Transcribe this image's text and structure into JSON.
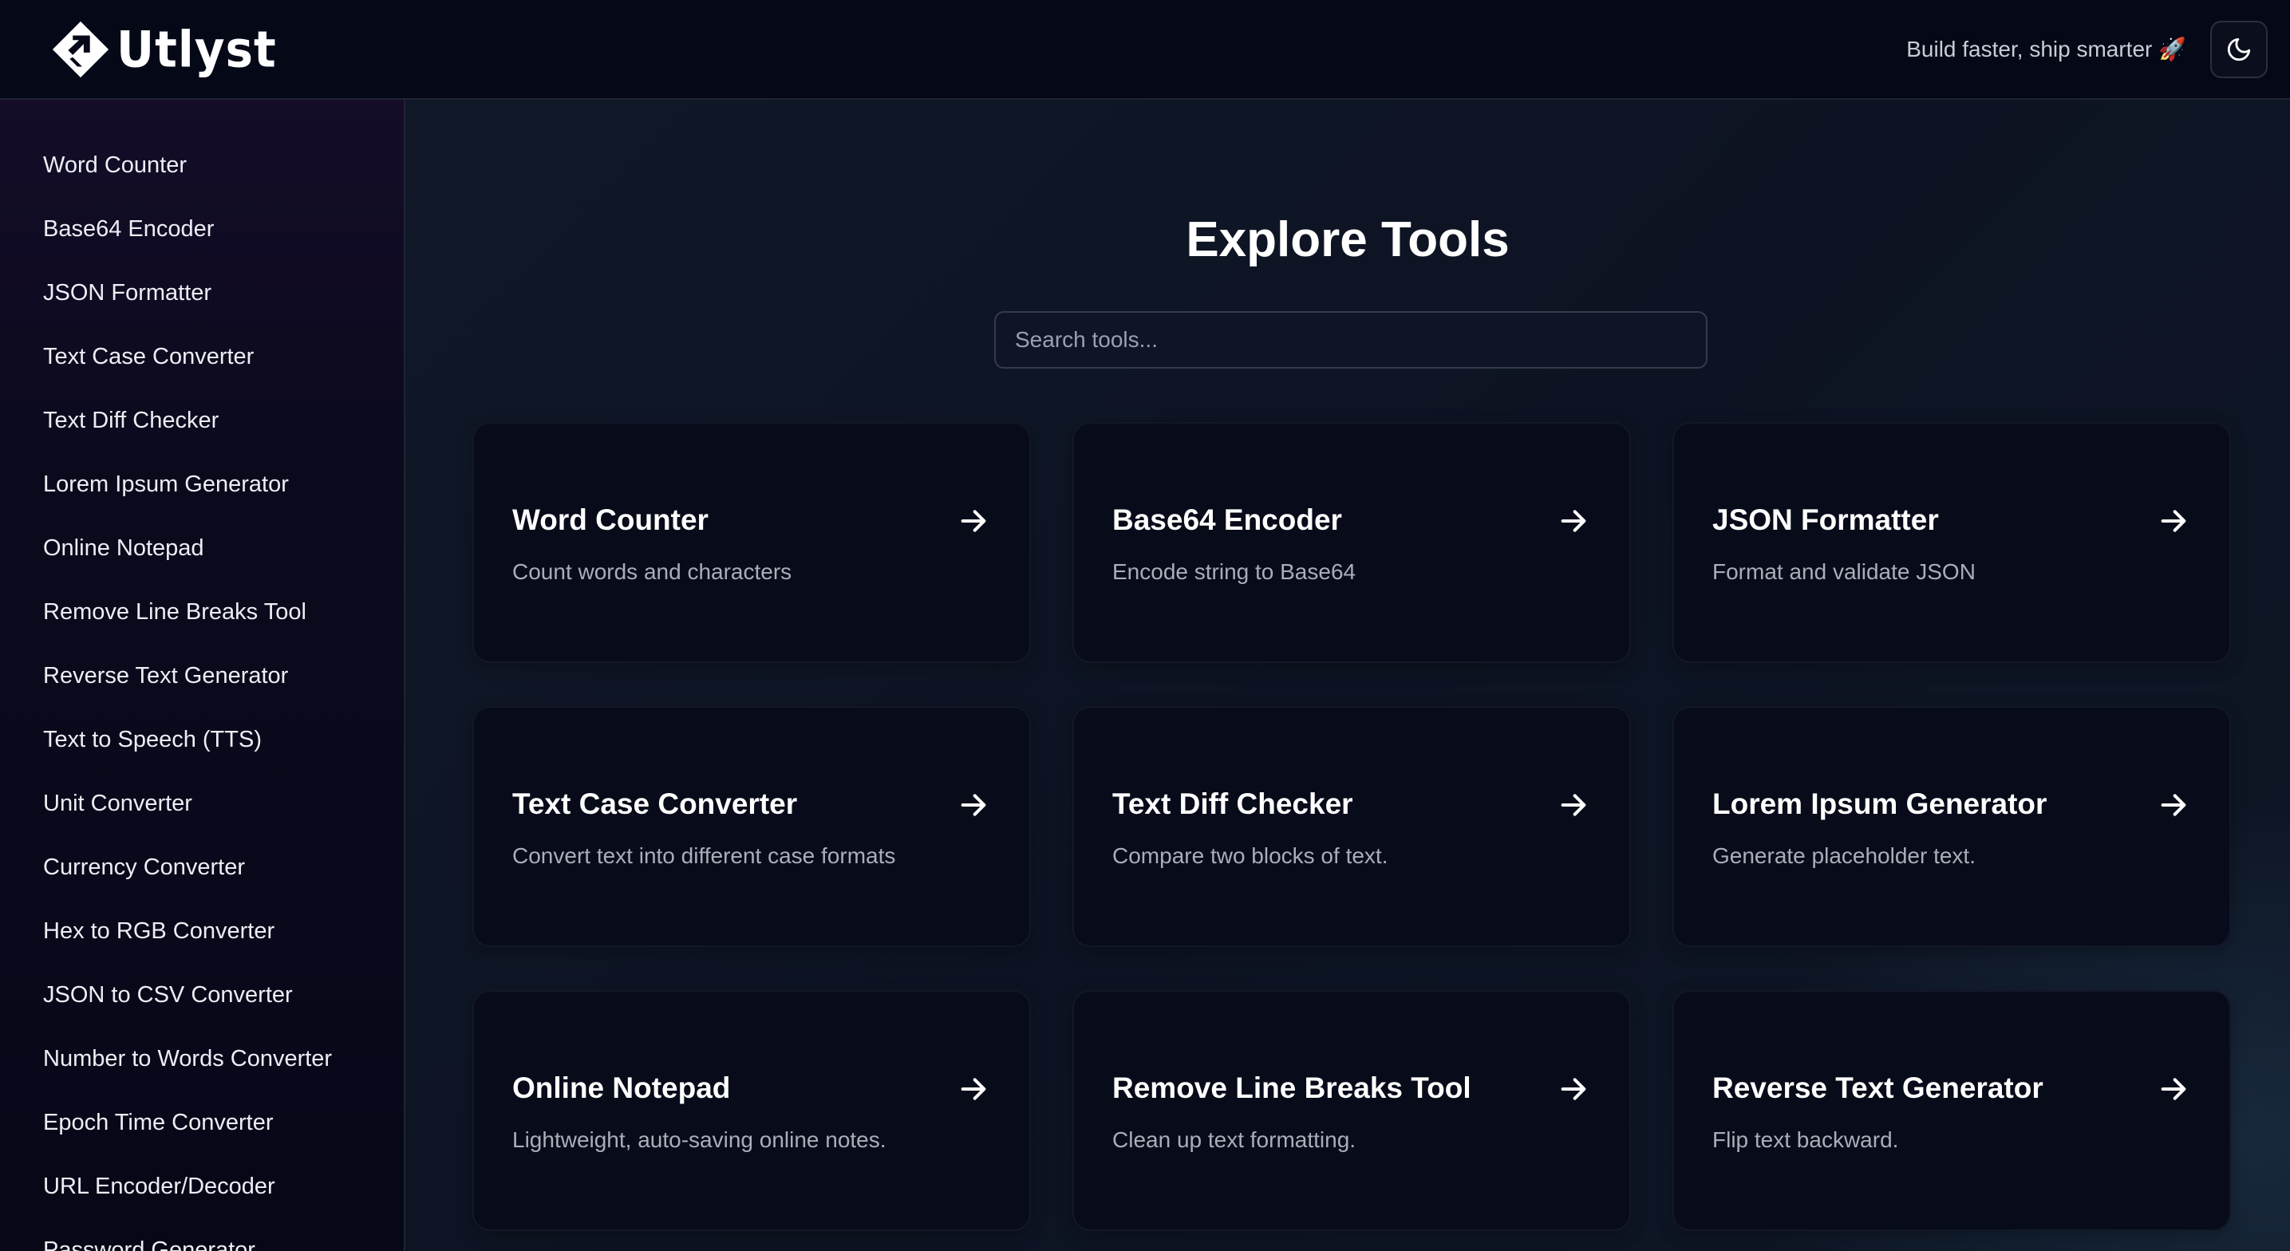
{
  "header": {
    "brand": "Utlyst",
    "tagline": "Build faster, ship smarter 🚀",
    "theme_toggle_icon": "moon-icon"
  },
  "sidebar": {
    "items": [
      {
        "label": "Word Counter"
      },
      {
        "label": "Base64 Encoder"
      },
      {
        "label": "JSON Formatter"
      },
      {
        "label": "Text Case Converter"
      },
      {
        "label": "Text Diff Checker"
      },
      {
        "label": "Lorem Ipsum Generator"
      },
      {
        "label": "Online Notepad"
      },
      {
        "label": "Remove Line Breaks Tool"
      },
      {
        "label": "Reverse Text Generator"
      },
      {
        "label": "Text to Speech (TTS)"
      },
      {
        "label": "Unit Converter"
      },
      {
        "label": "Currency Converter"
      },
      {
        "label": "Hex to RGB Converter"
      },
      {
        "label": "JSON to CSV Converter"
      },
      {
        "label": "Number to Words Converter"
      },
      {
        "label": "Epoch Time Converter"
      },
      {
        "label": "URL Encoder/Decoder"
      },
      {
        "label": "Password Generator"
      }
    ]
  },
  "main": {
    "title": "Explore Tools",
    "search": {
      "placeholder": "Search tools...",
      "value": ""
    },
    "cards": [
      {
        "title": "Word Counter",
        "desc": "Count words and characters"
      },
      {
        "title": "Base64 Encoder",
        "desc": "Encode string to Base64"
      },
      {
        "title": "JSON Formatter",
        "desc": "Format and validate JSON"
      },
      {
        "title": "Text Case Converter",
        "desc": "Convert text into different case formats"
      },
      {
        "title": "Text Diff Checker",
        "desc": "Compare two blocks of text."
      },
      {
        "title": "Lorem Ipsum Generator",
        "desc": "Generate placeholder text."
      },
      {
        "title": "Online Notepad",
        "desc": "Lightweight, auto-saving online notes."
      },
      {
        "title": "Remove Line Breaks Tool",
        "desc": "Clean up text formatting."
      },
      {
        "title": "Reverse Text Generator",
        "desc": "Flip text backward."
      }
    ]
  },
  "colors": {
    "header_bg": "#050817",
    "sidebar_bg": "#0a0a1c",
    "main_bg": "#0e1424",
    "card_bg": "#080b19",
    "text_primary": "#ffffff",
    "text_muted": "#a9aebb"
  }
}
